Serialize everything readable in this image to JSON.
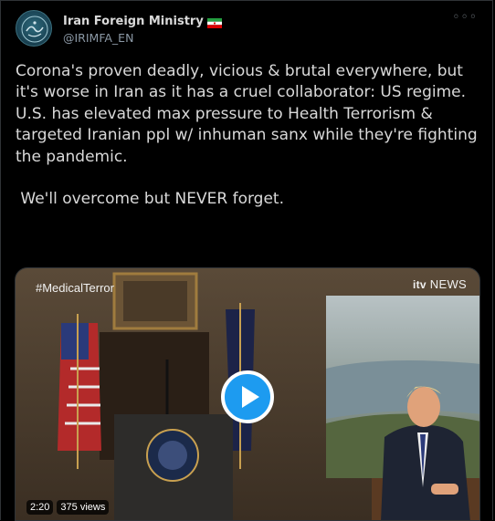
{
  "author": {
    "display_name": "Iran Foreign Ministry",
    "handle": "@IRIMFA_EN",
    "avatar_icon": "seal-icon",
    "flag_icon": "iran-flag-icon"
  },
  "more_icon": "more-dots-icon",
  "tweet": {
    "text": "Corona's proven deadly, vicious & brutal everywhere, but it's worse in Iran as it has a cruel collaborator: US regime.\nU.S. has elevated max pressure to Health Terrorism & targeted Iranian ppl w/ inhuman sanx while they're fighting the pandemic.\n\n We'll overcome but NEVER forget."
  },
  "media": {
    "hashtag_overlay": "#MedicalTerror",
    "broadcaster": {
      "logo": "itv",
      "label": "NEWS"
    },
    "duration": "2:20",
    "views": "375 views",
    "play_icon": "play-icon"
  },
  "colors": {
    "accent": "#1d9bf0",
    "text": "#d9d9d9",
    "muted": "#8b98a5"
  }
}
